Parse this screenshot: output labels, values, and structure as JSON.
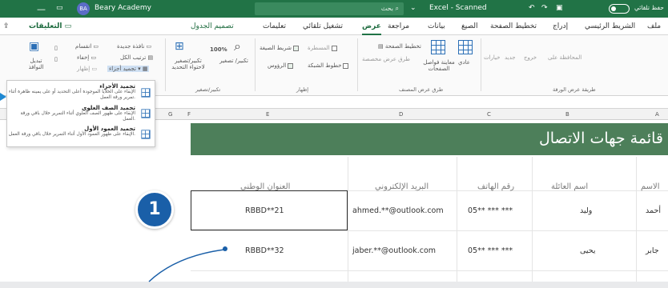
{
  "titlebar": {
    "account": "Beary Academy",
    "avatar_initials": "BA",
    "search_placeholder": "بحث",
    "file_name": "Excel - Scanned",
    "autosave": "حفظ تلقائي"
  },
  "tabs": [
    "ملف",
    "الشريط الرئيسي",
    "إدراج",
    "تخطيط الصفحة",
    "الصيغ",
    "بيانات",
    "مراجعة",
    "عرض",
    "تشغيل تلقائي",
    "تعليمات",
    "تصميم الجدول"
  ],
  "active_tab": "عرض",
  "comments_label": "التعليقات",
  "ribbon": {
    "sheet_view_group": "طريقة عرض الورقة",
    "sheet_view_items": [
      "المحافظة على",
      "خروج",
      "جديد",
      "خيارات"
    ],
    "workbook_views_group": "طرق عرض المصنف",
    "normal": "عادي",
    "page_break_preview": "معاينة فواصل الصفحات",
    "page_layout": "تخطيط الصفحة",
    "custom_views": "طرق عرض مخصصة",
    "show_group": "إظهار",
    "ruler": "المسطرة",
    "formula_bar": "شريط الصيغة",
    "gridlines": "خطوط الشبكة",
    "headings": "الرؤوس",
    "zoom_group": "تكبير/تصغير",
    "zoom": "تكبير/ تصغير",
    "zoom100": "100%",
    "zoom_selection": "تكبير/تصغير لاحتواء التحديد",
    "window_items": [
      "نافذة جديدة",
      "ترتيب الكل",
      "تجميد أجزاء",
      "انقسام",
      "إخفاء",
      "إظهار"
    ],
    "switch_windows": "تبديل النوافذ"
  },
  "freeze_menu": [
    {
      "title": "تجميد الأجزاء",
      "desc": "الإبقاء على الخلايا الموجودة أعلى التحديد أو على يمينه ظاهرة أثناء تمرير ورقة العمل."
    },
    {
      "title": "تجميد الصف العلوي",
      "desc": "الإبقاء على ظهور الصف العلوي أثناء التمرير خلال باقي ورقة العمل."
    },
    {
      "title": "تجميد العمود الأول",
      "desc": "الإبقاء على ظهور العمود الأول أثناء التمرير خلال باقي ورقة العمل."
    }
  ],
  "columns": [
    "A",
    "B",
    "C",
    "D",
    "E",
    "F",
    "G"
  ],
  "sheet": {
    "title": "قائمة جهات الاتصال",
    "headers": [
      "الاسم",
      "اسم العائلة",
      "رقم الهاتف",
      "البريد الإلكتروني",
      "العنوان الوطني"
    ],
    "rows": [
      [
        "أحمد",
        "وليد",
        "05** *** ***",
        "ahmed.**@outlook.com",
        "RBBD**21"
      ],
      [
        "جابر",
        "يحيى",
        "05** *** ***",
        "jaber.**@outlook.com",
        "RBBD**32"
      ]
    ]
  },
  "step_badge": "1"
}
